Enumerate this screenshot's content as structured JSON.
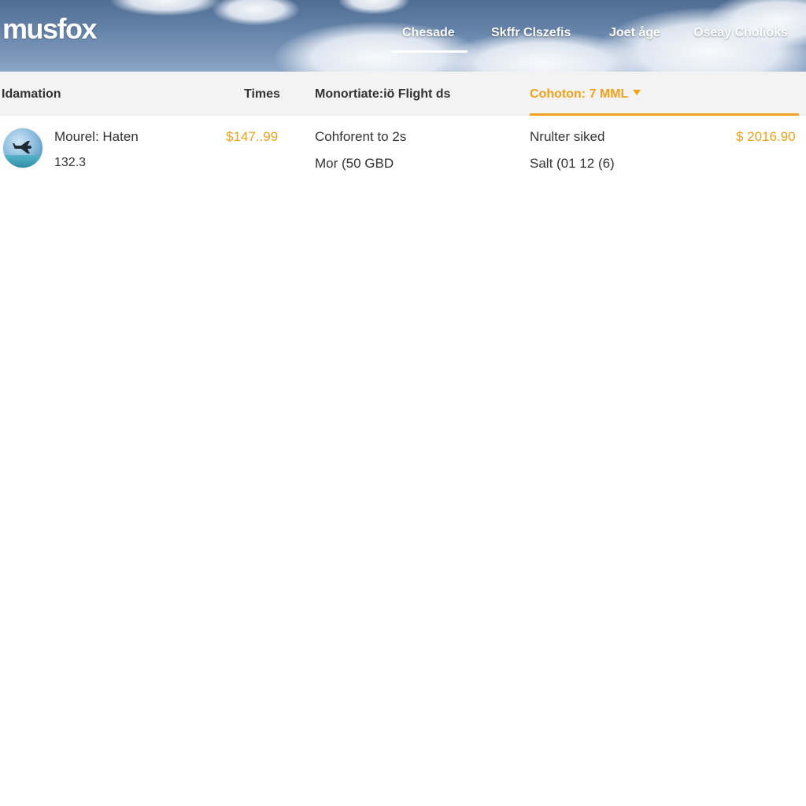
{
  "header": {
    "logo": "musfox",
    "nav": [
      {
        "label": "Chesade"
      },
      {
        "label": "Skffr Clszefis"
      },
      {
        "label": "Joet åge"
      },
      {
        "label": "Oseay Cholioks"
      }
    ]
  },
  "columns": {
    "c1": "Idamation",
    "c2": "Times",
    "c3": "Monortiate:iö Flight ds",
    "c4": "Cohoton: 7 MML"
  },
  "results": [
    {
      "name": "Mourel: Haten",
      "code": "132.3",
      "price": "$147..99",
      "detail_line1": "Cohforent to 2s",
      "detail_line2": "Mor (50 GBD",
      "info_line1": "Nrulter siked",
      "info_line2": "Salt (01 12 (6)",
      "total": "$ 2016.90"
    }
  ],
  "icons": {
    "avatar": "airplane-thumbnail-icon",
    "sort": "caret-down-icon"
  },
  "colors": {
    "accent": "#f0a21a",
    "header_bg": "#5a77a0"
  }
}
